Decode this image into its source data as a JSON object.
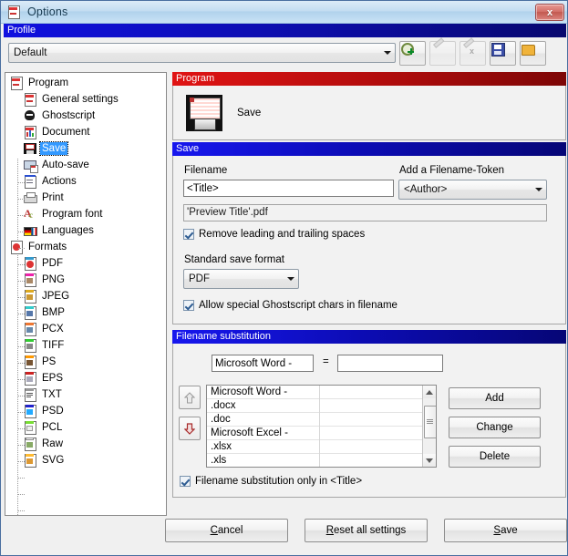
{
  "window": {
    "title": "Options",
    "title_icon": "options-document-icon",
    "close_label": "x"
  },
  "profile": {
    "band_label": "Profile",
    "selected": "Default",
    "toolbar": [
      {
        "name": "add-profile-button",
        "icon": "gear-plus-icon",
        "enabled": true
      },
      {
        "name": "rename-profile-button",
        "icon": "pencil-icon",
        "enabled": false
      },
      {
        "name": "delete-profile-button",
        "icon": "pencil-delete-icon",
        "enabled": false
      },
      {
        "name": "save-profile-button",
        "icon": "floppy-disk-icon",
        "enabled": true
      },
      {
        "name": "open-profile-button",
        "icon": "folder-open-icon",
        "enabled": true
      }
    ]
  },
  "tree": {
    "items": [
      {
        "label": "Program",
        "icon": "program-icon",
        "level": 0,
        "selected": false
      },
      {
        "label": "General settings",
        "icon": "general-icon",
        "level": 1,
        "selected": false
      },
      {
        "label": "Ghostscript",
        "icon": "ghostscript-icon",
        "level": 1,
        "selected": false
      },
      {
        "label": "Document",
        "icon": "document-icon",
        "level": 1,
        "selected": false
      },
      {
        "label": "Save",
        "icon": "save-floppy-icon",
        "level": 1,
        "selected": true
      },
      {
        "label": "Auto-save",
        "icon": "auto-save-icon",
        "level": 1,
        "selected": false
      },
      {
        "label": "Actions",
        "icon": "actions-icon",
        "level": 1,
        "selected": false
      },
      {
        "label": "Print",
        "icon": "printer-icon",
        "level": 1,
        "selected": false
      },
      {
        "label": "Program font",
        "icon": "font-icon",
        "level": 1,
        "selected": false
      },
      {
        "label": "Languages",
        "icon": "languages-flag-icon",
        "level": 1,
        "selected": false
      },
      {
        "label": "Formats",
        "icon": "formats-icon",
        "level": 0,
        "selected": false
      },
      {
        "label": "PDF",
        "icon": "pdf-icon",
        "level": 1,
        "selected": false
      },
      {
        "label": "PNG",
        "icon": "png-icon",
        "level": 1,
        "selected": false
      },
      {
        "label": "JPEG",
        "icon": "jpeg-icon",
        "level": 1,
        "selected": false
      },
      {
        "label": "BMP",
        "icon": "bmp-icon",
        "level": 1,
        "selected": false
      },
      {
        "label": "PCX",
        "icon": "pcx-icon",
        "level": 1,
        "selected": false
      },
      {
        "label": "TIFF",
        "icon": "tiff-icon",
        "level": 1,
        "selected": false
      },
      {
        "label": "PS",
        "icon": "ps-icon",
        "level": 1,
        "selected": false
      },
      {
        "label": "EPS",
        "icon": "eps-icon",
        "level": 1,
        "selected": false
      },
      {
        "label": "TXT",
        "icon": "txt-icon",
        "level": 1,
        "selected": false
      },
      {
        "label": "PSD",
        "icon": "psd-icon",
        "level": 1,
        "selected": false
      },
      {
        "label": "PCL",
        "icon": "pcl-icon",
        "level": 1,
        "selected": false
      },
      {
        "label": "Raw",
        "icon": "raw-icon",
        "level": 1,
        "selected": false
      },
      {
        "label": "SVG",
        "icon": "svg-icon",
        "level": 1,
        "selected": false
      }
    ]
  },
  "program_pane": {
    "header": "Program",
    "icon": "big-floppy-icon",
    "label": "Save"
  },
  "save_pane": {
    "header": "Save",
    "filename_label": "Filename",
    "filename_value": "<Title>",
    "token_label": "Add a Filename-Token",
    "token_value": "<Author>",
    "preview_value": "'Preview Title'.pdf",
    "remove_spaces_label": "Remove leading and trailing spaces",
    "remove_spaces_checked": true,
    "format_label": "Standard save format",
    "format_value": "PDF",
    "gs_chars_label": "Allow special Ghostscript chars in filename",
    "gs_chars_checked": true
  },
  "subst_pane": {
    "header": "Filename substitution",
    "find_value": "Microsoft Word -",
    "equals": "=",
    "replace_value": "",
    "replace_placeholder": "",
    "move_up": "move-up-arrow",
    "move_down": "move-down-arrow",
    "list_rows": [
      {
        "find": "Microsoft Word -",
        "replace": ""
      },
      {
        "find": ".docx",
        "replace": ""
      },
      {
        "find": ".doc",
        "replace": ""
      },
      {
        "find": "Microsoft Excel -",
        "replace": ""
      },
      {
        "find": ".xlsx",
        "replace": ""
      },
      {
        "find": ".xls",
        "replace": ""
      }
    ],
    "buttons": {
      "add": "Add",
      "change": "Change",
      "delete": "Delete"
    },
    "only_title_label": "Filename substitution only in <Title>",
    "only_title_checked": true
  },
  "footer": {
    "cancel": {
      "accel": "C",
      "rest": "ancel"
    },
    "reset": {
      "accel": "R",
      "rest": "eset all settings"
    },
    "save": {
      "accel": "S",
      "rest": "ave"
    }
  },
  "colors": {
    "band_blue": "#1111e0",
    "band_red": "#e01414",
    "selection": "#3399ff",
    "titlebar": "#c3ddf1",
    "close_red": "#c2584f"
  }
}
